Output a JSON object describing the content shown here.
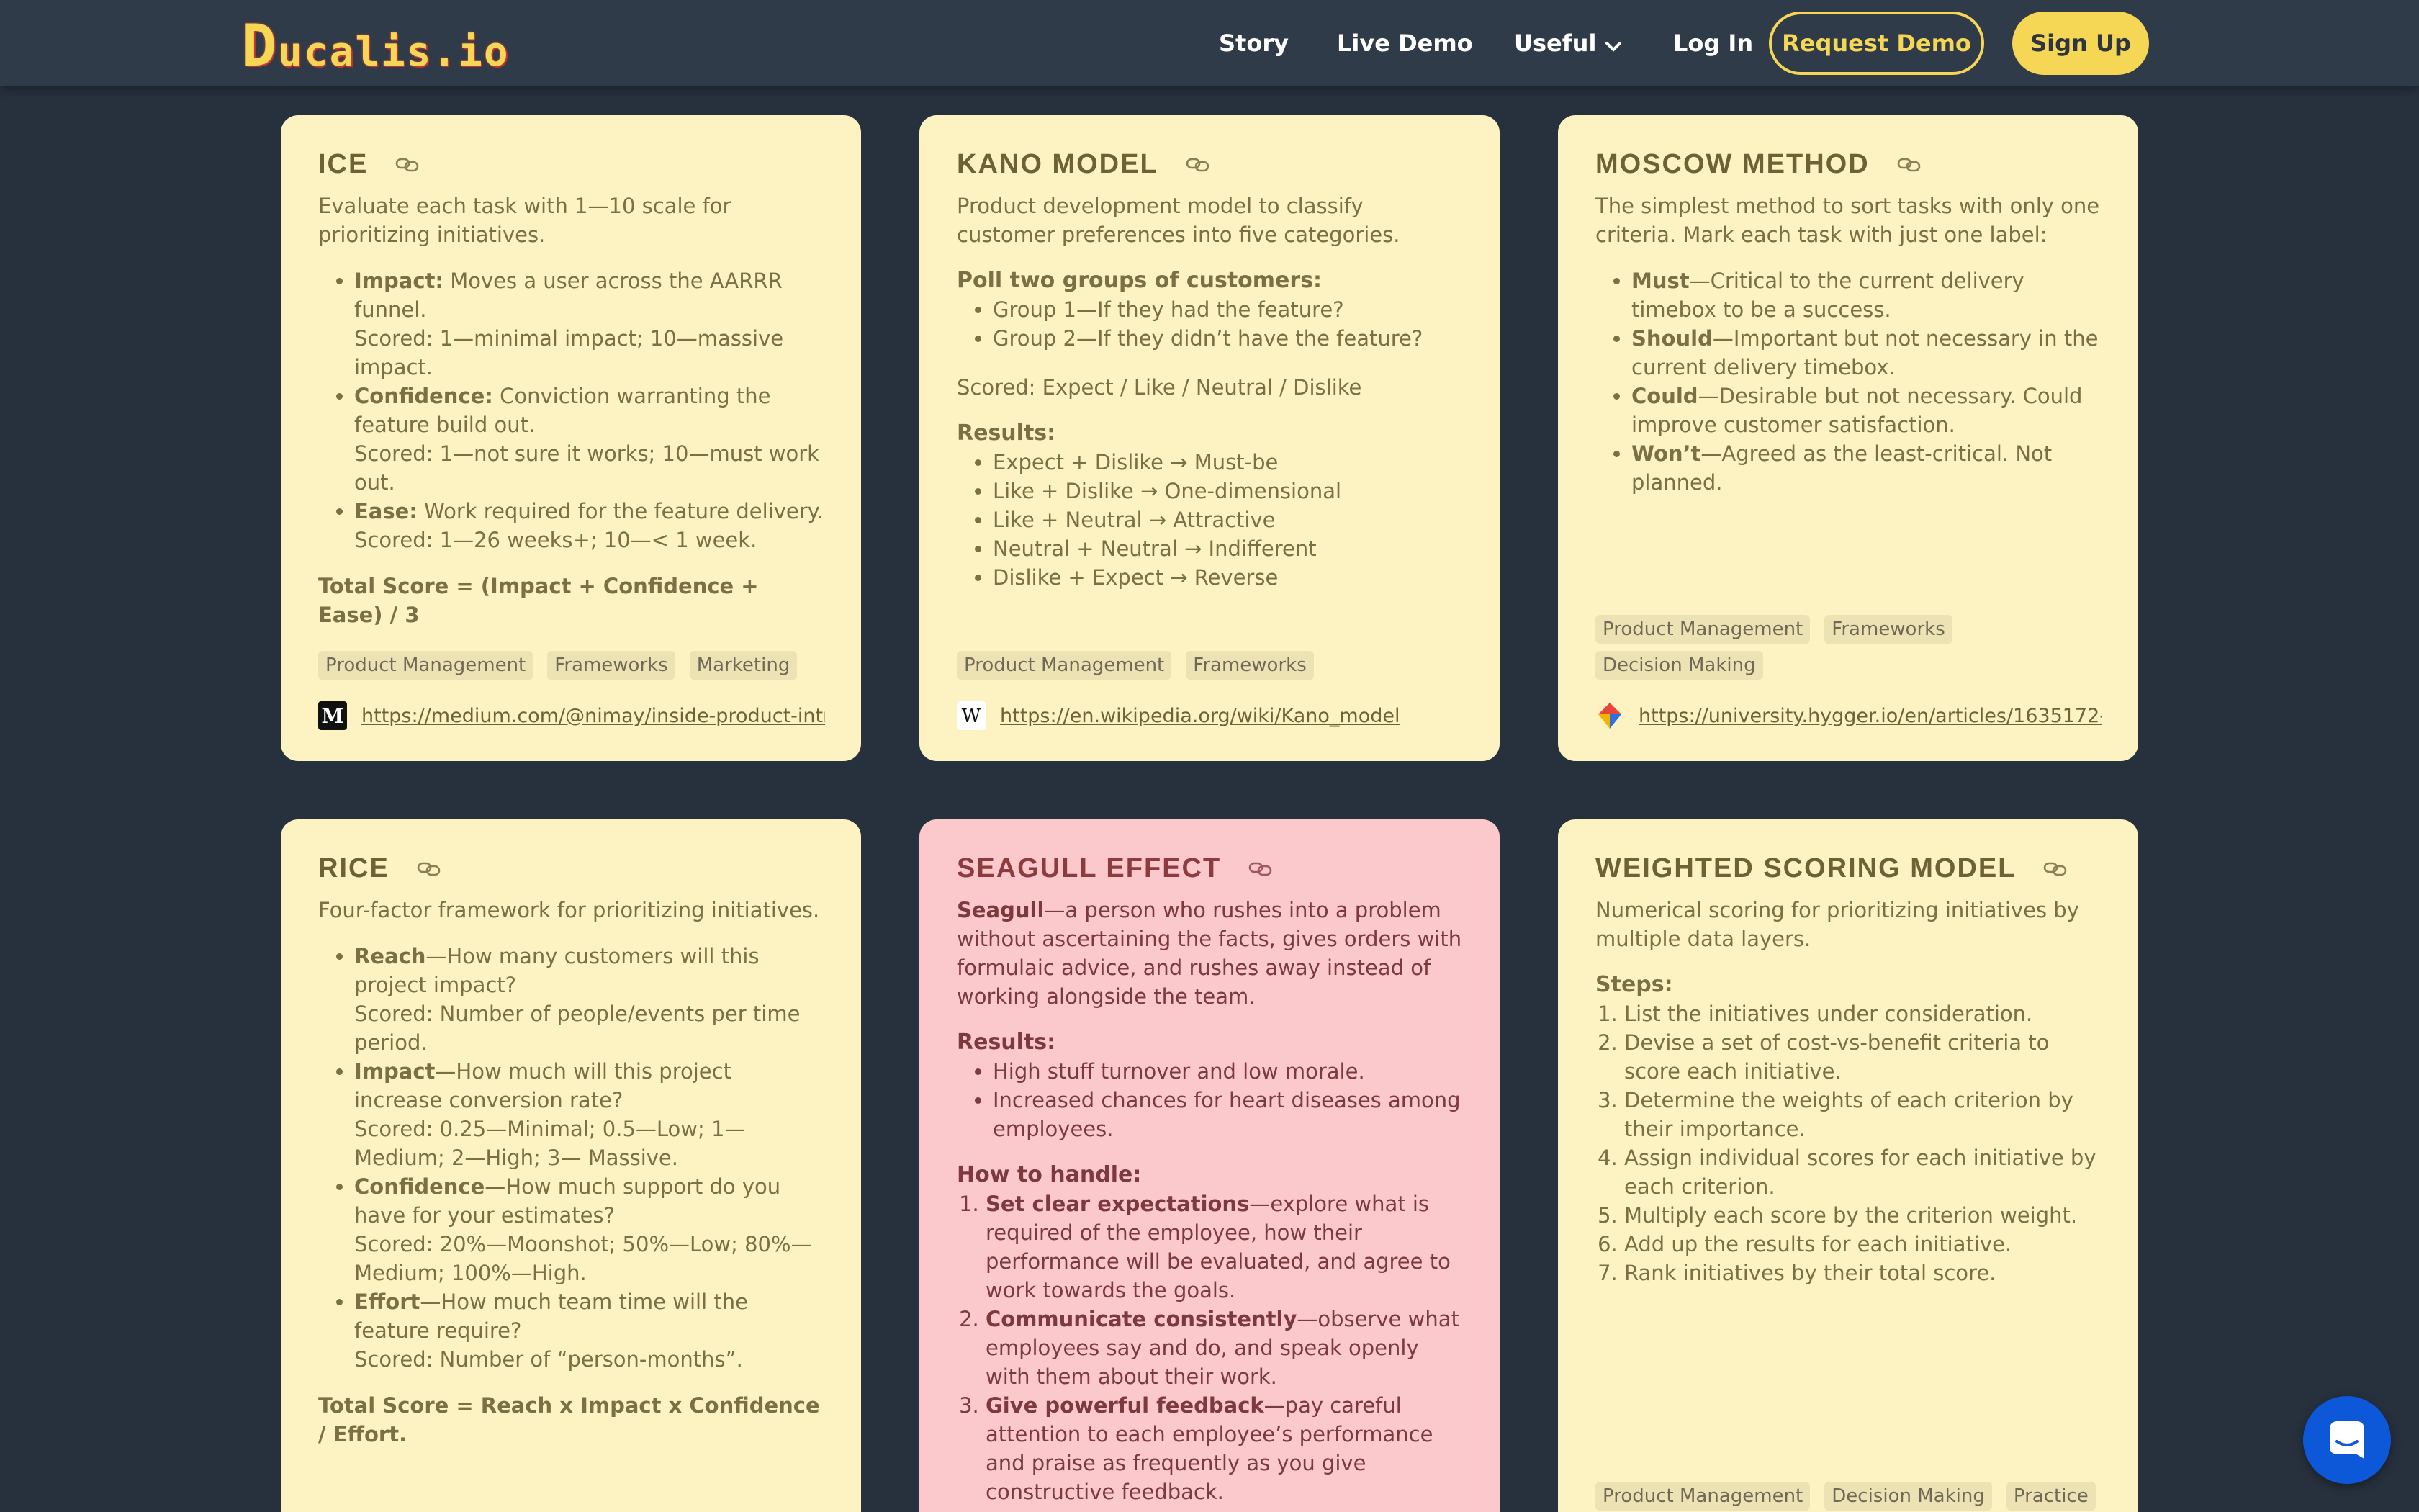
{
  "nav": {
    "logo_first": "D",
    "logo_rest": "ucalis.io",
    "story": "Story",
    "live_demo": "Live Demo",
    "useful": "Useful",
    "log_in": "Log In",
    "request_demo": "Request Demo",
    "sign_up": "Sign Up"
  },
  "colors": {
    "background": "#27313e",
    "nav": "#303b49",
    "accent": "#f6d655",
    "card_yellow": "#fdf2c2",
    "card_pink": "#fbc9cb",
    "chat": "#0d58d8"
  },
  "cards": {
    "ice": {
      "title": "ICE",
      "desc": "Evaluate each task with 1—10 scale for prioritizing initiatives.",
      "items": [
        {
          "label": "Impact:",
          "text": " Moves a user across the AARRR funnel.",
          "score": "Scored: 1—minimal impact; 10—massive impact."
        },
        {
          "label": "Confidence:",
          "text": " Conviction warranting the feature build out.",
          "score": "Scored: 1—not sure it works; 10—must work out."
        },
        {
          "label": "Ease:",
          "text": " Work required for the feature delivery.",
          "score": "Scored: 1—26 weeks+; 10—< 1 week."
        }
      ],
      "total": "Total Score = (Impact + Confidence + Ease) / 3",
      "tags": [
        "Product Management",
        "Frameworks",
        "Marketing"
      ],
      "source_icon": "medium-icon",
      "source_url": "https://medium.com/@nimay/inside-product-introduction-to-feature-priority-using-ice-impact-confidence-ease"
    },
    "kano": {
      "title": "KANO MODEL",
      "desc": "Product development model to classify customer preferences into five categories.",
      "poll_head": "Poll two groups of customers:",
      "poll": [
        "Group 1—If they had the feature?",
        "Group 2—If they didn’t have the feature?"
      ],
      "scored": "Scored: Expect / Like / Neutral / Dislike",
      "results_head": "Results:",
      "results": [
        "Expect + Dislike → Must-be",
        "Like + Dislike → One-dimensional",
        "Like + Neutral → Attractive",
        "Neutral + Neutral → Indifferent",
        "Dislike + Expect → Reverse"
      ],
      "tags": [
        "Product Management",
        "Frameworks"
      ],
      "source_icon": "wikipedia-icon",
      "source_url": "https://en.wikipedia.org/wiki/Kano_model"
    },
    "moscow": {
      "title": "MOSCOW METHOD",
      "desc": "The simplest method to sort tasks with only one criteria. Mark each task with just one label:",
      "items": [
        {
          "label": "Must",
          "text": "—Critical to the current delivery timebox to be a success."
        },
        {
          "label": "Should",
          "text": "—Important but not necessary in the current delivery timebox."
        },
        {
          "label": "Could",
          "text": "—Desirable but not necessary. Could improve customer satisfaction."
        },
        {
          "label": "Won’t",
          "text": "—Agreed as the least-critical. Not planned."
        }
      ],
      "tags": [
        "Product Management",
        "Frameworks",
        "Decision Making"
      ],
      "source_icon": "hygger-icon",
      "source_url": "https://university.hygger.io/en/articles/1635172-moscow-method"
    },
    "rice": {
      "title": "RICE",
      "desc": "Four-factor framework for prioritizing initiatives.",
      "items": [
        {
          "label": "Reach",
          "text": "—How many customers will this project impact?",
          "score": "Scored: Number of people/events per time period."
        },
        {
          "label": "Impact",
          "text": "—How much will this project increase conversion rate?",
          "score": "Scored: 0.25—Minimal; 0.5—Low; 1—Medium; 2—High; 3— Massive."
        },
        {
          "label": "Confidence",
          "text": "—How much support do you have for your estimates?",
          "score": "Scored: 20%—Moonshot; 50%—Low; 80%—Medium; 100%—High."
        },
        {
          "label": "Effort",
          "text": "—How much team time will the feature require?",
          "score": "Scored: Number of “person-months”."
        }
      ],
      "total": "Total Score = Reach x Impact x Confidence / Effort."
    },
    "seagull": {
      "title": "SEAGULL EFFECT",
      "desc_label": "Seagull",
      "desc": "—a person who rushes into a problem without ascertaining the facts, gives orders with formulaic advice, and rushes away instead of working alongside the team.",
      "results_head": "Results:",
      "results": [
        "High stuff turnover and low morale.",
        "Increased chances for heart diseases among employees."
      ],
      "handle_head": "How to handle:",
      "handle": [
        {
          "label": "Set clear expectations",
          "text": "—explore what is required of the employee, how their performance will be evaluated, and agree to work towards the goals."
        },
        {
          "label": "Communicate consistently",
          "text": "—observe what employees say and do, and speak openly with them about their work."
        },
        {
          "label": "Give powerful feedback",
          "text": "—pay careful attention to each employee’s performance and praise as frequently as you give constructive feedback."
        }
      ]
    },
    "weighted": {
      "title": "WEIGHTED SCORING MODEL",
      "desc": "Numerical scoring for prioritizing initiatives by multiple data layers.",
      "steps_head": "Steps:",
      "steps": [
        "List the initiatives under consideration.",
        "Devise a set of cost-vs-benefit criteria to score each initiative.",
        "Determine the weights of each criterion by their importance.",
        "Assign individual scores for each initiative by each criterion.",
        "Multiply each score by the criterion weight.",
        "Add up the results for each initiative.",
        "Rank initiatives by their total score."
      ],
      "tags": [
        "Product Management",
        "Decision Making",
        "Practice"
      ]
    }
  },
  "chat": {
    "icon": "chat-icon"
  }
}
